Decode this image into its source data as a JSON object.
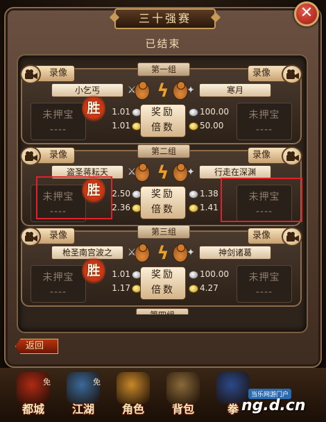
{
  "title": "三十强赛",
  "status": "已结束",
  "groups": [
    {
      "title": "第一组",
      "record_label": "录像",
      "left_name": "小乞丐",
      "right_name": "寒月",
      "left_bet": [
        "未押宝",
        "----"
      ],
      "right_bet": [
        "未押宝",
        "----"
      ],
      "win_label": "胜",
      "left_odds": [
        "1.01",
        "1.01"
      ],
      "right_odds": [
        "100.00",
        "50.00"
      ],
      "reward_label": [
        "奖励",
        "倍数"
      ]
    },
    {
      "title": "第二组",
      "record_label": "录像",
      "left_name": "盗圣蒋耘天",
      "right_name": "行走在深渊",
      "left_bet": [
        "未押宝",
        "----"
      ],
      "right_bet": [
        "未押宝",
        "----"
      ],
      "win_label": "胜",
      "left_odds": [
        "2.50",
        "2.36"
      ],
      "right_odds": [
        "1.38",
        "1.41"
      ],
      "reward_label": [
        "奖励",
        "倍数"
      ]
    },
    {
      "title": "第三组",
      "record_label": "录像",
      "left_name": "枪圣南宫波之",
      "right_name": "神剑诸葛",
      "left_bet": [
        "未押宝",
        "----"
      ],
      "right_bet": [
        "未押宝",
        "----"
      ],
      "win_label": "胜",
      "left_odds": [
        "1.01",
        "1.17"
      ],
      "right_odds": [
        "100.00",
        "4.27"
      ],
      "reward_label": [
        "奖励",
        "倍数"
      ]
    }
  ],
  "group4_title": "第四组",
  "back_label": "返回",
  "nav": [
    {
      "label": "都城",
      "badge": "免"
    },
    {
      "label": "江湖",
      "badge": "免"
    },
    {
      "label": "角色"
    },
    {
      "label": "背包"
    },
    {
      "label": "拳"
    }
  ],
  "watermark_top": "当乐网游门户",
  "watermark_main": "ng.d.cn",
  "colors": {
    "highlight": "#e0222a",
    "win": "#e0501a",
    "gold": "#c89210"
  }
}
